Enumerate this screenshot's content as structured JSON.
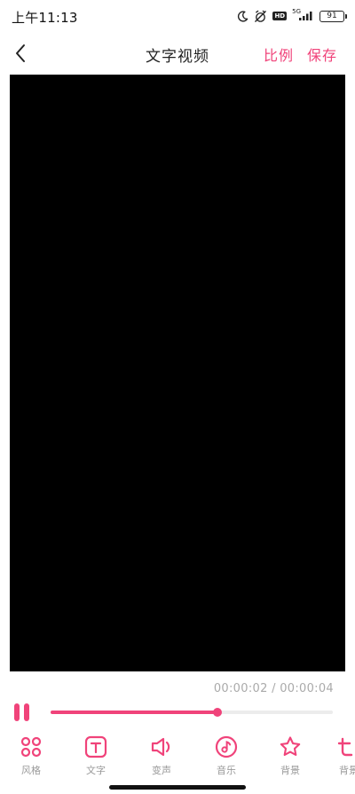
{
  "status_bar": {
    "time": "上午11:13",
    "net_label": "5G",
    "hd": "HD",
    "battery": "91"
  },
  "header": {
    "title": "文字视频",
    "ratio_label": "比例",
    "save_label": "保存"
  },
  "player": {
    "current_time": "00:00:02",
    "separator": " / ",
    "total_time": "00:00:04",
    "progress": 0.59
  },
  "toolbar": {
    "items": [
      {
        "label": "风格",
        "icon": "style-grid-icon"
      },
      {
        "label": "文字",
        "icon": "text-icon"
      },
      {
        "label": "变声",
        "icon": "voice-change-icon"
      },
      {
        "label": "音乐",
        "icon": "music-icon"
      },
      {
        "label": "背景",
        "icon": "star-icon"
      },
      {
        "label": "背景",
        "icon": "text-color-icon"
      }
    ]
  },
  "colors": {
    "accent": "#f0437a",
    "label_gray": "#9a9a9a",
    "video_bg": "#000000"
  }
}
